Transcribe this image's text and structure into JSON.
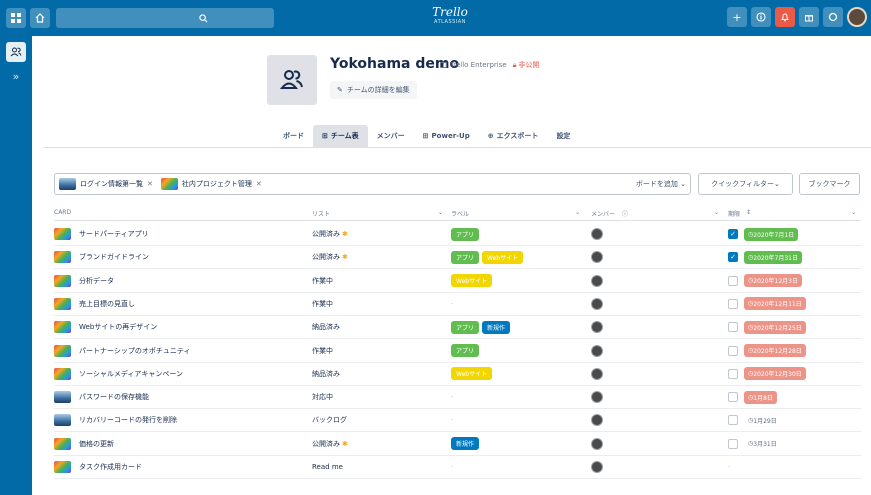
{
  "topbar": {
    "logo": "Trello",
    "logo_sub": "ATLASSIAN",
    "brand_color": "#026aa7",
    "left_icons": [
      "grid-icon",
      "home-icon",
      "search-icon"
    ],
    "right_icons": [
      "plus-icon",
      "info-icon",
      "bell-icon",
      "gift-icon",
      "circle-icon",
      "avatar"
    ]
  },
  "sidebar": {
    "team_icon": "team-icon",
    "expand": "»"
  },
  "team": {
    "name": "Yokohama demo",
    "plan": "Trello Enterprise",
    "visibility": "非公開",
    "edit_label": "チームの詳細を編集"
  },
  "tabs": [
    {
      "label": "ボード",
      "active": false
    },
    {
      "label": "チーム表",
      "active": true
    },
    {
      "label": "メンバー",
      "active": false
    },
    {
      "label": "Power-Up",
      "active": false
    },
    {
      "label": "エクスポート",
      "active": false
    },
    {
      "label": "設定",
      "active": false
    }
  ],
  "filters": {
    "chips": [
      {
        "label": "ログイン情報第一覧",
        "thumb": "blue"
      },
      {
        "label": "社内プロジェクト管理",
        "thumb": "rainbow"
      }
    ],
    "add_board": "ボードを追加",
    "quick_filter": "クイックフィルター",
    "bookmark": "ブックマーク"
  },
  "table": {
    "headers": {
      "card": "CARD",
      "list": "リスト",
      "label": "ラベル",
      "member": "メンバー",
      "due": "期限"
    },
    "rows": [
      {
        "thumb": "rainbow",
        "name": "サードパーティアプリ",
        "list": "公開済み",
        "star": true,
        "labels": [
          {
            "text": "アプリ",
            "color": "green"
          }
        ],
        "due_checked": true,
        "due": "2020年7月1日",
        "due_color": "green"
      },
      {
        "thumb": "rainbow",
        "name": "ブランドガイドライン",
        "list": "公開済み",
        "star": true,
        "labels": [
          {
            "text": "アプリ",
            "color": "green"
          },
          {
            "text": "Webサイト",
            "color": "yellow"
          }
        ],
        "due_checked": true,
        "due": "2020年7月31日",
        "due_color": "green"
      },
      {
        "thumb": "rainbow",
        "name": "分析データ",
        "list": "作業中",
        "star": false,
        "labels": [
          {
            "text": "Webサイト",
            "color": "yellow"
          }
        ],
        "due_checked": false,
        "due": "2020年12月3日",
        "due_color": "red"
      },
      {
        "thumb": "rainbow",
        "name": "売上目標の見直し",
        "list": "作業中",
        "star": false,
        "labels": [],
        "due_checked": false,
        "due": "2020年12月11日",
        "due_color": "red"
      },
      {
        "thumb": "rainbow",
        "name": "Webサイトの再デザイン",
        "list": "納品済み",
        "star": false,
        "labels": [
          {
            "text": "アプリ",
            "color": "green"
          },
          {
            "text": "新規作",
            "color": "blue"
          }
        ],
        "due_checked": false,
        "due": "2020年12月25日",
        "due_color": "red"
      },
      {
        "thumb": "rainbow",
        "name": "パートナーシップのオポチュニティ",
        "list": "作業中",
        "star": false,
        "labels": [
          {
            "text": "アプリ",
            "color": "green"
          }
        ],
        "due_checked": false,
        "due": "2020年12月28日",
        "due_color": "red"
      },
      {
        "thumb": "rainbow",
        "name": "ソーシャルメディアキャンペーン",
        "list": "納品済み",
        "star": false,
        "labels": [
          {
            "text": "Webサイト",
            "color": "yellow"
          }
        ],
        "due_checked": false,
        "due": "2020年12月30日",
        "due_color": "red"
      },
      {
        "thumb": "blue",
        "name": "パスワードの保存機能",
        "list": "対応中",
        "star": false,
        "labels": [],
        "due_checked": false,
        "due": "1月8日",
        "due_color": "red"
      },
      {
        "thumb": "blue",
        "name": "リカバリーコードの発行を削除",
        "list": "バックログ",
        "star": false,
        "labels": [],
        "due_checked": false,
        "due": "1月29日",
        "due_color": "plain"
      },
      {
        "thumb": "rainbow",
        "name": "価格の更新",
        "list": "公開済み",
        "star": true,
        "labels": [
          {
            "text": "新規作",
            "color": "blue"
          }
        ],
        "due_checked": false,
        "due": "3月31日",
        "due_color": "plain"
      },
      {
        "thumb": "rainbow",
        "name": "タスク作成用カード",
        "list": "Read me",
        "star": false,
        "labels": [],
        "due_checked": null,
        "due": "",
        "due_color": "none"
      }
    ]
  }
}
